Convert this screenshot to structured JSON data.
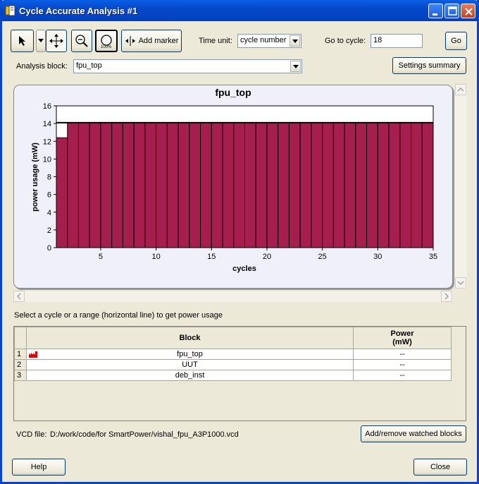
{
  "window": {
    "title": "Cycle Accurate Analysis #1"
  },
  "toolbar": {
    "add_marker_label": "Add marker",
    "time_unit_label": "Time unit:",
    "time_unit_value": "cycle number",
    "goto_label": "Go to cycle:",
    "goto_value": "18",
    "go_label": "Go",
    "analysis_block_label": "Analysis block:",
    "analysis_block_value": "fpu_top",
    "settings_summary_label": "Settings summary"
  },
  "chart_data": {
    "type": "bar",
    "title": "fpu_top",
    "xlabel": "cycles",
    "ylabel": "power usage (mW)",
    "xlim": [
      1,
      35
    ],
    "ylim": [
      0,
      16
    ],
    "x_ticks": [
      5,
      10,
      15,
      20,
      25,
      30,
      35
    ],
    "y_ticks": [
      0,
      2,
      4,
      6,
      8,
      10,
      12,
      14,
      16
    ],
    "x": [
      1,
      2,
      3,
      4,
      5,
      6,
      7,
      8,
      9,
      10,
      11,
      12,
      13,
      14,
      15,
      16,
      17,
      18,
      19,
      20,
      21,
      22,
      23,
      24,
      25,
      26,
      27,
      28,
      29,
      30,
      31,
      32,
      33,
      34
    ],
    "values": [
      12.4,
      14.1,
      14.1,
      14.1,
      14.1,
      14.1,
      14.1,
      14.1,
      14.1,
      14.1,
      14.1,
      14.1,
      14.1,
      14.1,
      14.1,
      14.1,
      14.1,
      14.1,
      14.1,
      14.1,
      14.1,
      14.1,
      14.1,
      14.1,
      14.1,
      14.1,
      14.1,
      14.1,
      14.1,
      14.1,
      14.1,
      14.1,
      14.1,
      14.1
    ],
    "range_line_value": 14.1,
    "bar_color": "#a61e4d",
    "grid": false
  },
  "hint_text": "Select a cycle or a range (horizontal line) to get power usage",
  "grid": {
    "headers": {
      "block": "Block",
      "power": "Power\n(mW)"
    },
    "rows": [
      {
        "num": "1",
        "block": "fpu_top",
        "power": "--"
      },
      {
        "num": "2",
        "block": "UUT",
        "power": "--"
      },
      {
        "num": "3",
        "block": "deb_inst",
        "power": "--"
      }
    ]
  },
  "footer": {
    "vcd_label": "VCD file:",
    "vcd_path": "D:/work/code/for SmartPower/vishal_fpu_A3P1000.vcd",
    "add_remove_label": "Add/remove watched blocks",
    "help_label": "Help",
    "close_label": "Close"
  }
}
